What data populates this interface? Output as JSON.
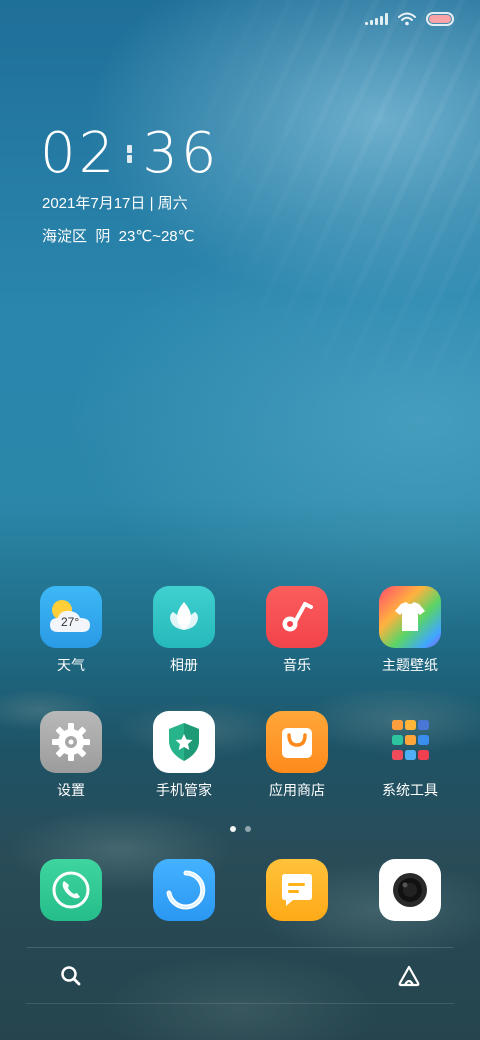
{
  "status_bar": {
    "signal_icon": "signal-icon",
    "wifi_icon": "wifi-icon",
    "battery_icon": "battery-icon"
  },
  "clock_widget": {
    "hour": "02",
    "minute": "36",
    "date": "2021年7月17日 | 周六",
    "weather": "海淀区  阴  23℃~28℃"
  },
  "apps": [
    {
      "label": "天气",
      "icon": "weather-icon",
      "badge": "27°"
    },
    {
      "label": "相册",
      "icon": "gallery-icon"
    },
    {
      "label": "音乐",
      "icon": "music-icon"
    },
    {
      "label": "主题壁纸",
      "icon": "themes-icon"
    },
    {
      "label": "设置",
      "icon": "settings-icon"
    },
    {
      "label": "手机管家",
      "icon": "security-icon"
    },
    {
      "label": "应用商店",
      "icon": "app-store-icon"
    },
    {
      "label": "系统工具",
      "icon": "tools-folder-icon"
    }
  ],
  "page_indicator": {
    "pages": 2,
    "active": 0
  },
  "dock": [
    {
      "icon": "phone-icon"
    },
    {
      "icon": "browser-icon"
    },
    {
      "icon": "messages-icon"
    },
    {
      "icon": "camera-icon"
    }
  ],
  "bottom_bar": {
    "left_icon": "search-icon",
    "right_icon": "assistant-icon"
  },
  "colors": {
    "wallpaper_top": "#1f6f99",
    "wallpaper_bottom": "#23434d",
    "battery_fill": "#f7a3a8"
  }
}
